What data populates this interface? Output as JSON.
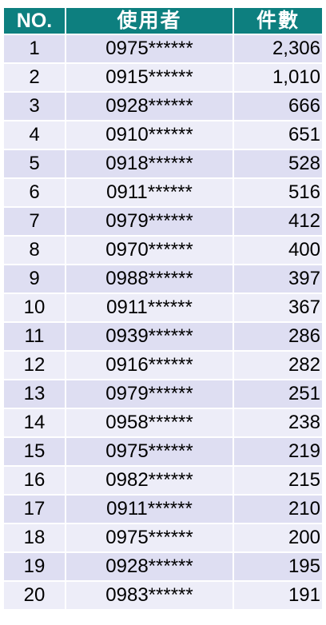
{
  "colors": {
    "header_bg": "#0d7f7f",
    "row_odd_bg": "#dedef2",
    "row_even_bg": "#ededf8",
    "header_text": "#ffffff"
  },
  "header": {
    "no": "NO.",
    "user": "使用者",
    "count": "件數"
  },
  "rows": [
    {
      "no": "1",
      "user": "0975******",
      "count": "2,306"
    },
    {
      "no": "2",
      "user": "0915******",
      "count": "1,010"
    },
    {
      "no": "3",
      "user": "0928******",
      "count": "666"
    },
    {
      "no": "4",
      "user": "0910******",
      "count": "651"
    },
    {
      "no": "5",
      "user": "0918******",
      "count": "528"
    },
    {
      "no": "6",
      "user": "0911******",
      "count": "516"
    },
    {
      "no": "7",
      "user": "0979******",
      "count": "412"
    },
    {
      "no": "8",
      "user": "0970******",
      "count": "400"
    },
    {
      "no": "9",
      "user": "0988******",
      "count": "397"
    },
    {
      "no": "10",
      "user": "0911******",
      "count": "367"
    },
    {
      "no": "11",
      "user": "0939******",
      "count": "286"
    },
    {
      "no": "12",
      "user": "0916******",
      "count": "282"
    },
    {
      "no": "13",
      "user": "0979******",
      "count": "251"
    },
    {
      "no": "14",
      "user": "0958******",
      "count": "238"
    },
    {
      "no": "15",
      "user": "0975******",
      "count": "219"
    },
    {
      "no": "16",
      "user": "0982******",
      "count": "215"
    },
    {
      "no": "17",
      "user": "0911******",
      "count": "210"
    },
    {
      "no": "18",
      "user": "0975******",
      "count": "200"
    },
    {
      "no": "19",
      "user": "0928******",
      "count": "195"
    },
    {
      "no": "20",
      "user": "0983******",
      "count": "191"
    }
  ]
}
